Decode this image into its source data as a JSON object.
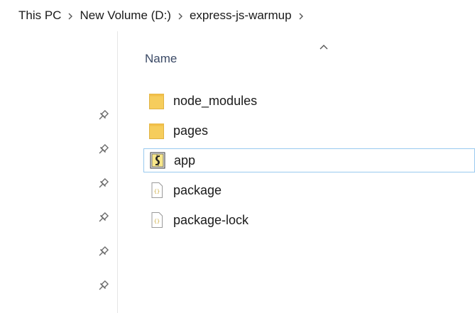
{
  "breadcrumb": {
    "items": [
      "This PC",
      "New Volume (D:)",
      "express-js-warmup"
    ]
  },
  "header": {
    "column_name": "Name",
    "sort": "ascending"
  },
  "files": [
    {
      "name": "node_modules",
      "icon": "folder-icon",
      "type": "folder"
    },
    {
      "name": "pages",
      "icon": "folder-icon",
      "type": "folder"
    },
    {
      "name": "app",
      "icon": "js-script-icon",
      "type": "script",
      "selected": true
    },
    {
      "name": "package",
      "icon": "json-file-icon",
      "type": "json"
    },
    {
      "name": "package-lock",
      "icon": "json-file-icon",
      "type": "json"
    }
  ],
  "colors": {
    "folder": "#f6cd5c",
    "selection_border": "#99c9ef",
    "header_text": "#3b4a66"
  },
  "nav_pins": [
    "pin-icon",
    "pin-icon",
    "pin-icon",
    "pin-icon",
    "pin-icon",
    "pin-icon"
  ]
}
